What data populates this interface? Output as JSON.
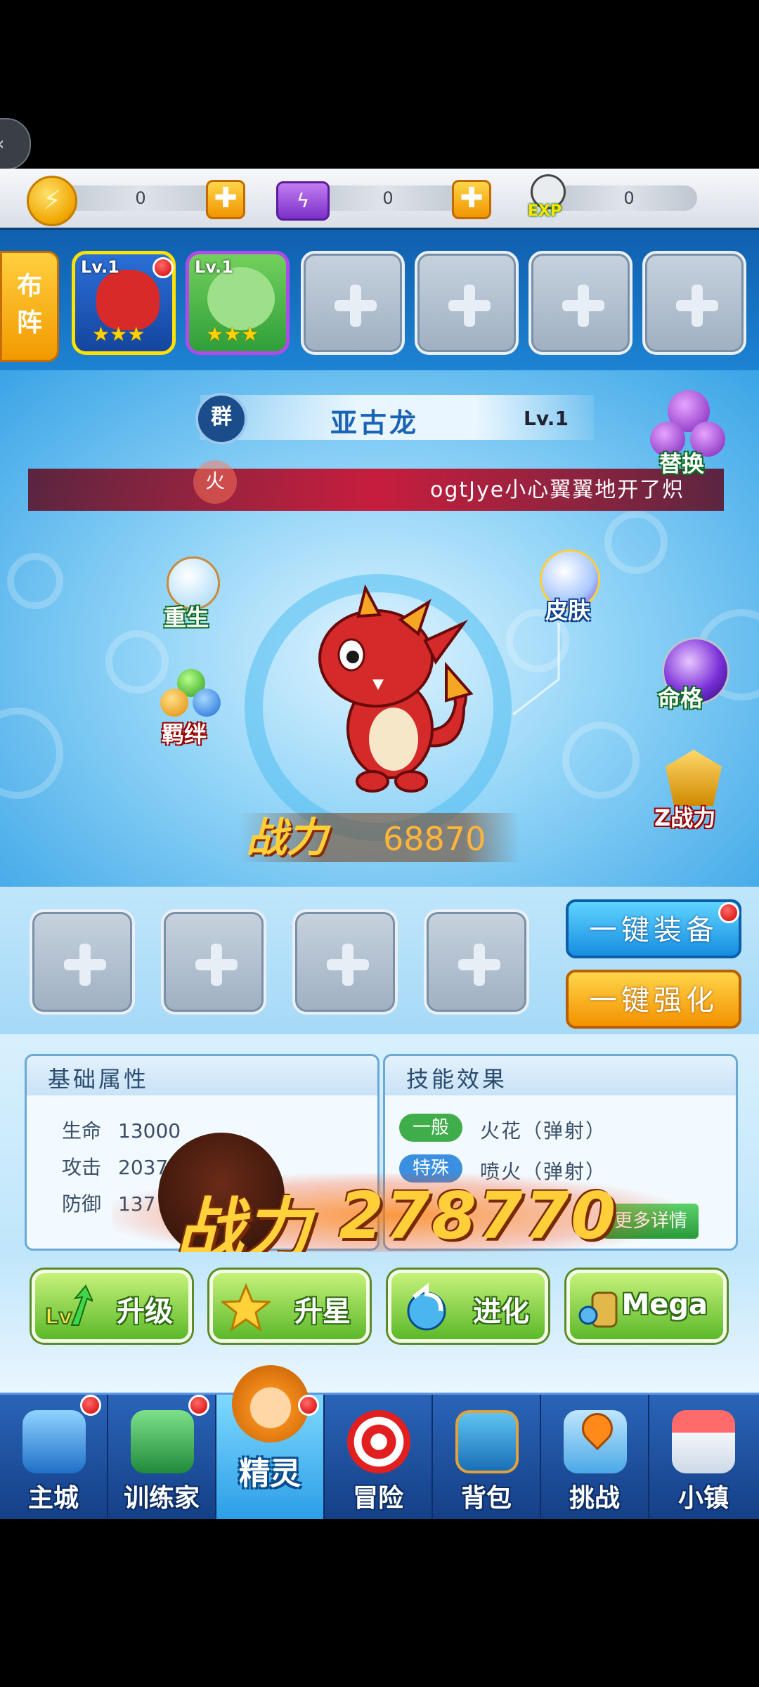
{
  "resources": {
    "gold": {
      "icon": "gold-coin-icon",
      "value": "0"
    },
    "energy": {
      "icon": "energy-bolt-icon",
      "value": "0"
    },
    "exp": {
      "icon": "exp-bunny-icon",
      "label": "EXP",
      "value": "0"
    },
    "plus_symbol": "✚"
  },
  "team": {
    "formation_label_1": "布",
    "formation_label_2": "阵",
    "slots": [
      {
        "level": "Lv.1",
        "stars": "★★★"
      },
      {
        "level": "Lv.1",
        "stars": "★★★"
      }
    ]
  },
  "pet": {
    "group_badge": "群",
    "name": "亚古龙",
    "level": "Lv.1",
    "element": "火",
    "marquee": "ogtJye小心翼翼地开了炽",
    "combat_label": "战力",
    "combat_power": "68870"
  },
  "side_menu": {
    "swap": "替换",
    "rebirth": "重生",
    "bond": "羁绊",
    "skin": "皮肤",
    "fate": "命格",
    "z_power": "Z战力"
  },
  "equipment": {
    "equip_all_label": "一键装备",
    "enhance_all_label": "一键强化"
  },
  "stats": {
    "title": "基础属性",
    "rows": [
      {
        "label": "生命",
        "value": "13000"
      },
      {
        "label": "攻击",
        "value": "2037"
      },
      {
        "label": "防御",
        "value": "137"
      }
    ]
  },
  "skills": {
    "title": "技能效果",
    "items": [
      {
        "tag": "一般",
        "name": "火花（弹射）",
        "color": "#3fae4a"
      },
      {
        "tag": "特殊",
        "name": "喷火（弹射）",
        "color": "#3a8fe0"
      }
    ],
    "more_label": "更多详情"
  },
  "total_power": {
    "label": "战力",
    "value": "278770"
  },
  "actions": [
    {
      "label": "升级",
      "icon": "level-up-arrow-icon"
    },
    {
      "label": "升星",
      "icon": "star-icon"
    },
    {
      "label": "进化",
      "icon": "evolve-swirl-icon"
    },
    {
      "label": "Mega",
      "icon": "mega-stone-icon"
    }
  ],
  "nav": [
    {
      "label": "主城",
      "icon": "castle-icon"
    },
    {
      "label": "训练家",
      "icon": "trainer-glove-icon"
    },
    {
      "label": "精灵",
      "icon": "pet-trainer-icon"
    },
    {
      "label": "冒险",
      "icon": "target-icon"
    },
    {
      "label": "背包",
      "icon": "backpack-icon"
    },
    {
      "label": "挑战",
      "icon": "map-pin-icon"
    },
    {
      "label": "小镇",
      "icon": "town-icon"
    }
  ],
  "colors": {
    "accent_blue": "#1d83d3",
    "gold": "#ffcf3a",
    "badge_red": "#d40000"
  }
}
